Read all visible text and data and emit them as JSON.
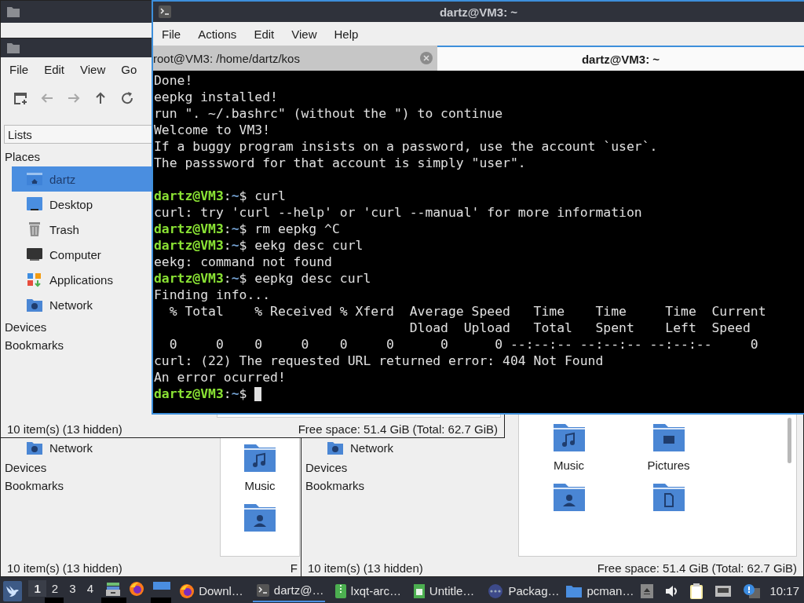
{
  "file_manager_main": {
    "menu": [
      "File",
      "Edit",
      "View",
      "Go"
    ],
    "toolbar": [
      {
        "kind": "new-window",
        "disabled": false
      },
      {
        "kind": "back",
        "disabled": true
      },
      {
        "kind": "forward",
        "disabled": true
      },
      {
        "kind": "up",
        "disabled": false
      },
      {
        "kind": "reload",
        "disabled": false
      }
    ],
    "sidebar_mode": "Lists",
    "places_heading": "Places",
    "places": [
      {
        "label": "dartz",
        "kind": "home",
        "selected": true
      },
      {
        "label": "Desktop",
        "kind": "desktop",
        "selected": false
      },
      {
        "label": "Trash",
        "kind": "trash",
        "selected": false
      },
      {
        "label": "Computer",
        "kind": "computer",
        "selected": false
      },
      {
        "label": "Applications",
        "kind": "apps",
        "selected": false
      },
      {
        "label": "Network",
        "kind": "network",
        "selected": false
      }
    ],
    "sections": [
      "Devices",
      "Bookmarks"
    ],
    "status": {
      "items": "10 item(s) (13 hidden)",
      "free_space": "Free space: 51.4 GiB (Total: 62.7 GiB)"
    }
  },
  "file_manager_left": {
    "places": [
      {
        "label": "Network",
        "kind": "network",
        "selected": false
      }
    ],
    "sections": [
      "Devices",
      "Bookmarks"
    ],
    "folders": [
      {
        "label": "Music",
        "kind": "music"
      },
      {
        "kind": "user"
      }
    ],
    "status": {
      "items": "10 item(s) (13 hidden)",
      "free_space": "F"
    }
  },
  "file_manager_right": {
    "places": [
      {
        "label": "Network",
        "kind": "network",
        "selected": false
      }
    ],
    "sections": [
      "Devices",
      "Bookmarks"
    ],
    "folders": [
      {
        "label": "Music",
        "kind": "music"
      },
      {
        "label": "Pictures",
        "kind": "pictures"
      },
      {
        "kind": "user"
      },
      {
        "kind": "document"
      }
    ],
    "status": {
      "items": "10 item(s) (13 hidden)",
      "free_space": "Free space: 51.4 GiB (Total: 62.7 GiB)"
    }
  },
  "terminal": {
    "title": "dartz@VM3: ~",
    "menu": [
      "File",
      "Actions",
      "Edit",
      "View",
      "Help"
    ],
    "tabs": [
      {
        "label": "root@VM3: /home/dartz/kos",
        "selected": false,
        "closable": true
      },
      {
        "label": "dartz@VM3: ~",
        "selected": true,
        "closable": false
      }
    ],
    "lines": [
      {
        "kind": "output",
        "text": "Done!"
      },
      {
        "kind": "output",
        "text": "eepkg installed!"
      },
      {
        "kind": "output",
        "text": "run \". ~/.bashrc\" (without the \") to continue"
      },
      {
        "kind": "output",
        "text": "Welcome to VM3!"
      },
      {
        "kind": "output",
        "text": "If a buggy program insists on a password, use the account `user`."
      },
      {
        "kind": "output",
        "text": "The passsword for that account is simply \"user\"."
      },
      {
        "kind": "blank"
      },
      {
        "kind": "prompt",
        "user": "dartz@VM3",
        "sep": ":",
        "path": "~",
        "end": "$",
        "command": "curl",
        "cursor": false
      },
      {
        "kind": "output",
        "text": "curl: try 'curl --help' or 'curl --manual' for more information"
      },
      {
        "kind": "prompt",
        "user": "dartz@VM3",
        "sep": ":",
        "path": "~",
        "end": "$",
        "command": "rm eepkg ^C",
        "cursor": false
      },
      {
        "kind": "prompt",
        "user": "dartz@VM3",
        "sep": ":",
        "path": "~",
        "end": "$",
        "command": "eekg desc curl",
        "cursor": false
      },
      {
        "kind": "output",
        "text": "eekg: command not found"
      },
      {
        "kind": "prompt",
        "user": "dartz@VM3",
        "sep": ":",
        "path": "~",
        "end": "$",
        "command": "eepkg desc curl",
        "cursor": false
      },
      {
        "kind": "output",
        "text": "Finding info..."
      },
      {
        "kind": "output",
        "text": "  % Total    % Received % Xferd  Average Speed   Time    Time     Time  Current"
      },
      {
        "kind": "output",
        "text": "                                 Dload  Upload   Total   Spent    Left  Speed"
      },
      {
        "kind": "output",
        "text": "  0     0    0     0    0     0      0      0 --:--:-- --:--:-- --:--:--     0"
      },
      {
        "kind": "output",
        "text": "curl: (22) The requested URL returned error: 404 Not Found"
      },
      {
        "kind": "output",
        "text": "An error ocurred!"
      },
      {
        "kind": "prompt",
        "user": "dartz@VM3",
        "sep": ":",
        "path": "~",
        "end": "$",
        "cursor": true
      }
    ]
  },
  "taskbar": {
    "desktops": [
      {
        "label": "1",
        "selected": true
      },
      {
        "label": "2",
        "selected": false
      },
      {
        "label": "3",
        "selected": false
      },
      {
        "label": "4",
        "selected": false
      }
    ],
    "launchers": [
      {
        "kind": "files"
      },
      {
        "kind": "browser"
      },
      {
        "kind": "display"
      }
    ],
    "tasks": [
      {
        "label": "Downl…",
        "kind": "browser",
        "selected": false
      },
      {
        "label": "dartz@…",
        "kind": "terminal",
        "selected": true
      },
      {
        "label": "lxqt-arc…",
        "kind": "archive",
        "selected": false
      },
      {
        "label": "Untitle…",
        "kind": "spreadsheet",
        "selected": false
      },
      {
        "label": "Packag…",
        "kind": "packages",
        "selected": false
      },
      {
        "label": "pcman…",
        "kind": "folder",
        "selected": false
      }
    ],
    "tray": [
      {
        "kind": "eject"
      },
      {
        "kind": "volume"
      },
      {
        "kind": "clipboard"
      },
      {
        "kind": "network"
      },
      {
        "kind": "notification"
      }
    ],
    "clock": "10:17"
  }
}
